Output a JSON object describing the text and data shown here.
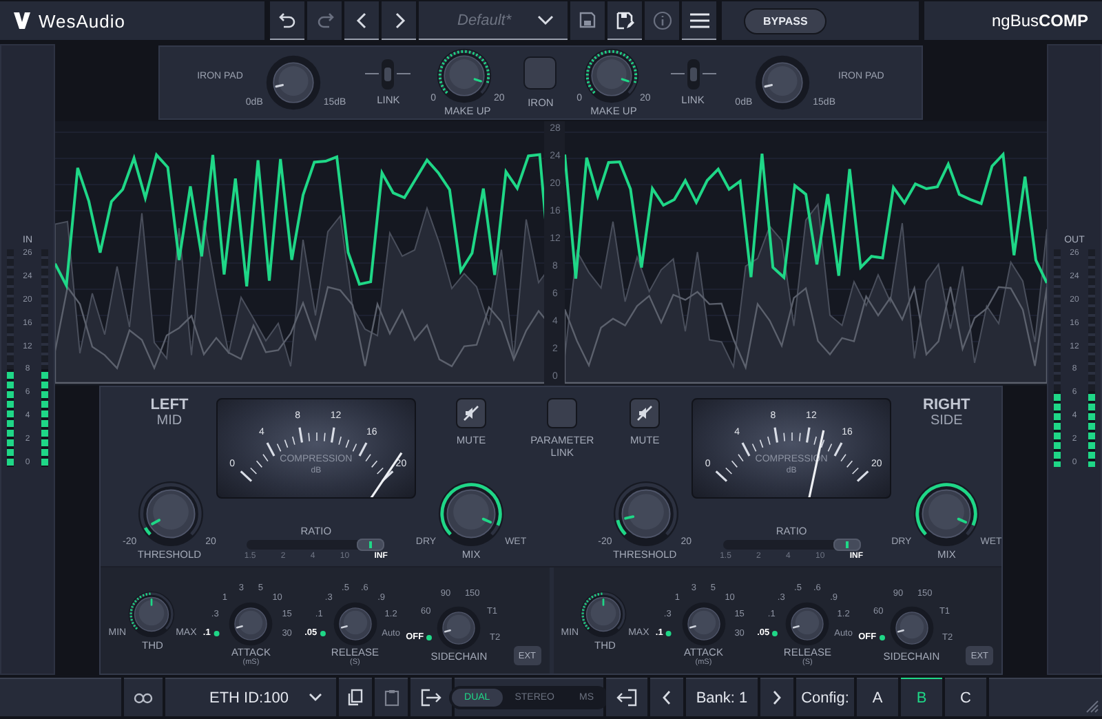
{
  "header": {
    "logo": "WesAudio",
    "preset": "Default*",
    "bypass": "BYPASS",
    "product": "ngBus**COMP**"
  },
  "top_module": {
    "controls": [
      {
        "kind": "pad_knob",
        "label": "IRON PAD",
        "min": "0dB",
        "max": "15dB"
      },
      {
        "kind": "toggle",
        "label": "LINK",
        "on": false
      },
      {
        "kind": "makeup_knob",
        "label": "MAKE UP",
        "min": "0",
        "max": "20"
      },
      {
        "kind": "button",
        "label": "IRON"
      },
      {
        "kind": "makeup_knob",
        "label": "MAKE UP",
        "min": "0",
        "max": "20"
      },
      {
        "kind": "toggle",
        "label": "LINK",
        "on": false
      },
      {
        "kind": "pad_knob",
        "label": "IRON PAD",
        "min": "0dB",
        "max": "15dB"
      }
    ]
  },
  "input_meter": {
    "label": "IN",
    "scale": [
      "26",
      "24",
      "20",
      "16",
      "12",
      "8",
      "6",
      "4",
      "2",
      "0"
    ],
    "bars": [
      {
        "level": 0.45
      },
      {
        "level": 0.45
      }
    ]
  },
  "output_meter": {
    "label": "OUT",
    "scale": [
      "26",
      "24",
      "20",
      "16",
      "12",
      "8",
      "6",
      "4",
      "2",
      "0"
    ],
    "bars": [
      {
        "level": 0.35
      },
      {
        "level": 0.35
      }
    ]
  },
  "graph": {
    "scale": [
      "28",
      "24",
      "20",
      "16",
      "12",
      "8",
      "6",
      "4",
      "2",
      "0"
    ]
  },
  "channels": [
    {
      "title": "LEFT",
      "subtitle": "MID",
      "threshold": {
        "label": "THRESHOLD",
        "min": "-20",
        "max": "20"
      },
      "meter": {
        "scale": [
          "0",
          "4",
          "8",
          "12",
          "16",
          "20"
        ],
        "label": "COMPRESSION",
        "unit": "dB"
      },
      "ratio": {
        "label": "RATIO",
        "steps": [
          {
            "label": "1.5",
            "selected": false
          },
          {
            "label": "2",
            "selected": false
          },
          {
            "label": "4",
            "selected": false
          },
          {
            "label": "10",
            "selected": false
          },
          {
            "label": "INF",
            "selected": true
          }
        ]
      },
      "mute": {
        "label": "MUTE"
      },
      "mix": {
        "label": "MIX",
        "min": "DRY",
        "max": "WET"
      }
    },
    {
      "title": "RIGHT",
      "subtitle": "SIDE",
      "threshold": {
        "label": "THRESHOLD",
        "min": "-20",
        "max": "20"
      },
      "meter": {
        "scale": [
          "0",
          "4",
          "8",
          "12",
          "16",
          "20"
        ],
        "label": "COMPRESSION",
        "unit": "dB"
      },
      "ratio": {
        "label": "RATIO",
        "steps": [
          {
            "label": "1.5",
            "selected": false
          },
          {
            "label": "2",
            "selected": false
          },
          {
            "label": "4",
            "selected": false
          },
          {
            "label": "10",
            "selected": false
          },
          {
            "label": "INF",
            "selected": true
          }
        ]
      },
      "mute": {
        "label": "MUTE"
      },
      "mix": {
        "label": "MIX",
        "min": "DRY",
        "max": "WET"
      }
    }
  ],
  "parameter_link": "PARAMETER LINK",
  "sections": [
    {
      "thd": {
        "label": "THD",
        "min": "MIN",
        "max": "MAX"
      },
      "attack": {
        "label": "ATTACK",
        "unit": "(mS)",
        "steps": [
          {
            "label": ".1",
            "selected": true
          },
          {
            "label": ".3",
            "selected": false
          },
          {
            "label": "1",
            "selected": false
          },
          {
            "label": "3",
            "selected": false
          },
          {
            "label": "5",
            "selected": false
          },
          {
            "label": "10",
            "selected": false
          },
          {
            "label": "15",
            "selected": false
          },
          {
            "label": "30",
            "selected": false
          }
        ]
      },
      "release": {
        "label": "RELEASE",
        "unit": "(S)",
        "steps": [
          {
            "label": ".05",
            "selected": true
          },
          {
            "label": ".1",
            "selected": false
          },
          {
            "label": ".3",
            "selected": false
          },
          {
            "label": ".5",
            "selected": false
          },
          {
            "label": ".6",
            "selected": false
          },
          {
            "label": ".9",
            "selected": false
          },
          {
            "label": "1.2",
            "selected": false
          },
          {
            "label": "Auto",
            "selected": false
          }
        ]
      },
      "sidechain": {
        "label": "SIDECHAIN",
        "steps": [
          {
            "label": "OFF",
            "selected": true
          },
          {
            "label": "60",
            "selected": false
          },
          {
            "label": "90",
            "selected": false
          },
          {
            "label": "150",
            "selected": false
          },
          {
            "label": "T1",
            "selected": false
          },
          {
            "label": "T2",
            "selected": false
          }
        ]
      },
      "ext": "EXT"
    },
    {
      "thd": {
        "label": "THD",
        "min": "MIN",
        "max": "MAX"
      },
      "attack": {
        "label": "ATTACK",
        "unit": "(mS)",
        "steps": [
          {
            "label": ".1",
            "selected": true
          },
          {
            "label": ".3",
            "selected": false
          },
          {
            "label": "1",
            "selected": false
          },
          {
            "label": "3",
            "selected": false
          },
          {
            "label": "5",
            "selected": false
          },
          {
            "label": "10",
            "selected": false
          },
          {
            "label": "15",
            "selected": false
          },
          {
            "label": "30",
            "selected": false
          }
        ]
      },
      "release": {
        "label": "RELEASE",
        "unit": "(S)",
        "steps": [
          {
            "label": ".05",
            "selected": true
          },
          {
            "label": ".1",
            "selected": false
          },
          {
            "label": ".3",
            "selected": false
          },
          {
            "label": ".5",
            "selected": false
          },
          {
            "label": ".6",
            "selected": false
          },
          {
            "label": ".9",
            "selected": false
          },
          {
            "label": "1.2",
            "selected": false
          },
          {
            "label": "Auto",
            "selected": false
          }
        ]
      },
      "sidechain": {
        "label": "SIDECHAIN",
        "steps": [
          {
            "label": "OFF",
            "selected": true
          },
          {
            "label": "60",
            "selected": false
          },
          {
            "label": "90",
            "selected": false
          },
          {
            "label": "150",
            "selected": false
          },
          {
            "label": "T1",
            "selected": false
          },
          {
            "label": "T2",
            "selected": false
          }
        ]
      },
      "ext": "EXT"
    }
  ],
  "footer": {
    "device": "ETH ID:100",
    "modes": [
      {
        "label": "DUAL",
        "selected": true
      },
      {
        "label": "STEREO",
        "selected": false
      },
      {
        "label": "MS",
        "selected": false
      }
    ],
    "bank": "Bank: 1",
    "config_label": "Config:",
    "configs": [
      {
        "label": "A",
        "selected": false
      },
      {
        "label": "B",
        "selected": true
      },
      {
        "label": "C",
        "selected": false
      }
    ]
  }
}
